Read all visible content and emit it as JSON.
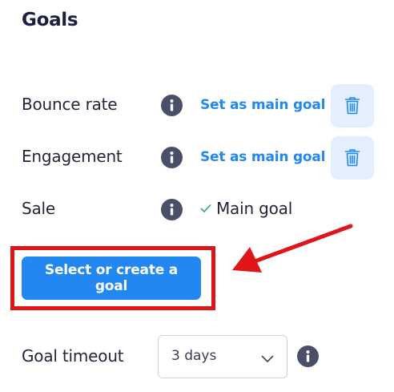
{
  "section_title": "Goals",
  "goals": [
    {
      "name": "Bounce rate",
      "action_label": "Set as main goal",
      "is_main": false
    },
    {
      "name": "Engagement",
      "action_label": "Set as main goal",
      "is_main": false
    },
    {
      "name": "Sale",
      "status_label": "Main goal",
      "is_main": true
    }
  ],
  "primary_button_label": "Select or create a goal",
  "goal_timeout": {
    "label": "Goal timeout",
    "selected": "3 days"
  },
  "colors": {
    "accent": "#2287f0",
    "trash_bg": "#e3effd",
    "info_icon": "#4a4e68",
    "annotation_red": "#e0151a",
    "check_green": "#3cb371"
  },
  "icons": {
    "info": "info-icon",
    "delete": "trash-icon",
    "check": "check-icon",
    "dropdown": "chevron-down-icon"
  }
}
